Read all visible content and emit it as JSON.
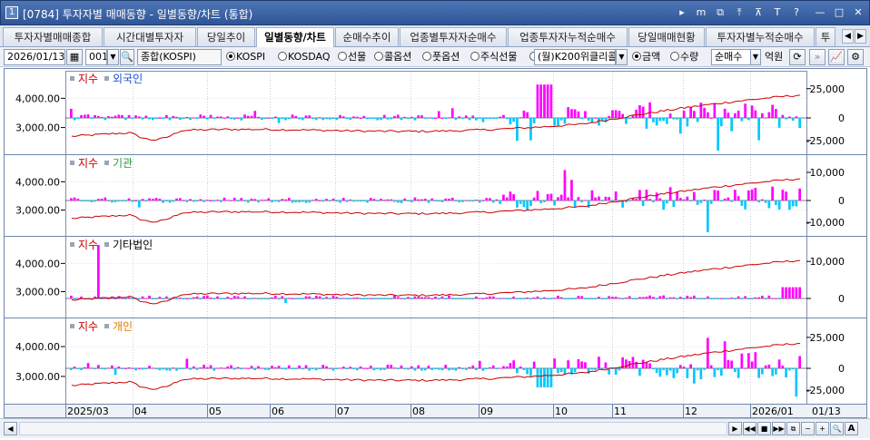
{
  "window": {
    "number": "1",
    "title": "[0784] 투자자별 매매동향 - 일별동향/차트 (통합)",
    "buttons": [
      "▸",
      "m",
      "⧉",
      "⤒",
      "⊼",
      "T",
      "?",
      "—",
      "□",
      "✕"
    ]
  },
  "tabs": [
    {
      "label": "투자자별매매종합",
      "active": false
    },
    {
      "label": "시간대별투자자",
      "active": false
    },
    {
      "label": "당일추이",
      "active": false
    },
    {
      "label": "일별동향/차트",
      "active": true
    },
    {
      "label": "순매수추이",
      "active": false
    },
    {
      "label": "업종별투자자순매수",
      "active": false
    },
    {
      "label": "업종투자자누적순매수",
      "active": false
    },
    {
      "label": "당일매매현황",
      "active": false
    },
    {
      "label": "투자자별누적순매수",
      "active": false
    },
    {
      "label": "투",
      "active": false
    }
  ],
  "toolbar": {
    "date": "2026/01/13",
    "code": "001",
    "index_name": "종합(KOSPI)",
    "markets": [
      {
        "label": "KOSPI",
        "selected": true
      },
      {
        "label": "KOSDAQ",
        "selected": false
      },
      {
        "label": "선물",
        "selected": false
      },
      {
        "label": "콜옵션",
        "selected": false
      },
      {
        "label": "풋옵션",
        "selected": false
      },
      {
        "label": "주식선물",
        "selected": false
      },
      {
        "label": "",
        "selected": false
      }
    ],
    "product_select": "(월)K200위클리콜",
    "units": [
      {
        "label": "금액",
        "selected": true
      },
      {
        "label": "수량",
        "selected": false
      }
    ],
    "type_select": "순매수",
    "unit_label": "억원"
  },
  "chart_data": [
    {
      "type": "bar",
      "panel": "외국인",
      "legend": [
        "지수",
        "외국인"
      ],
      "colors": {
        "index": "#cc0000",
        "positive": "#ff00ff",
        "negative": "#00c8ff",
        "legend_investor": "#1a4fd6"
      },
      "left_ticks": [
        "4,000.00",
        "3,000.00"
      ],
      "right_ticks": [
        "25,000",
        "0",
        "-25,000"
      ],
      "bar_range": [
        -30000,
        30000
      ],
      "index_range": [
        2400,
        4700
      ]
    },
    {
      "type": "bar",
      "panel": "기관",
      "legend": [
        "지수",
        "기관"
      ],
      "colors": {
        "index": "#cc0000",
        "positive": "#ff00ff",
        "negative": "#00c8ff",
        "legend_investor": "#2a9a3a"
      },
      "left_ticks": [
        "4,000.00",
        "3,000.00"
      ],
      "right_ticks": [
        "10,000",
        "0",
        "-10,000"
      ],
      "bar_range": [
        -16000,
        16000
      ],
      "index_range": [
        2400,
        4700
      ]
    },
    {
      "type": "bar",
      "panel": "기타법인",
      "legend": [
        "지수",
        "기타법인"
      ],
      "colors": {
        "index": "#cc0000",
        "positive": "#ff00ff",
        "negative": "#00c8ff",
        "legend_investor": "#000000"
      },
      "left_ticks": [
        "4,000.00",
        "3,000.00"
      ],
      "right_ticks": [
        "10,000",
        "0"
      ],
      "bar_range": [
        -10000,
        15000
      ],
      "index_range": [
        2400,
        4700
      ]
    },
    {
      "type": "bar",
      "panel": "개인",
      "legend": [
        "지수",
        "개인"
      ],
      "colors": {
        "index": "#cc0000",
        "positive": "#ff00ff",
        "negative": "#00c8ff",
        "legend_investor": "#e07a00"
      },
      "left_ticks": [
        "4,000.00",
        "3,000.00"
      ],
      "right_ticks": [
        "25,000",
        "0",
        "-25,000"
      ],
      "bar_range": [
        -30000,
        30000
      ],
      "index_range": [
        2400,
        4700
      ]
    }
  ],
  "x_axis": {
    "labels": [
      "2025/03",
      "04",
      "05",
      "06",
      "07",
      "08",
      "09",
      "10",
      "11",
      "12",
      "2026/01"
    ],
    "right_label": "01/13"
  }
}
